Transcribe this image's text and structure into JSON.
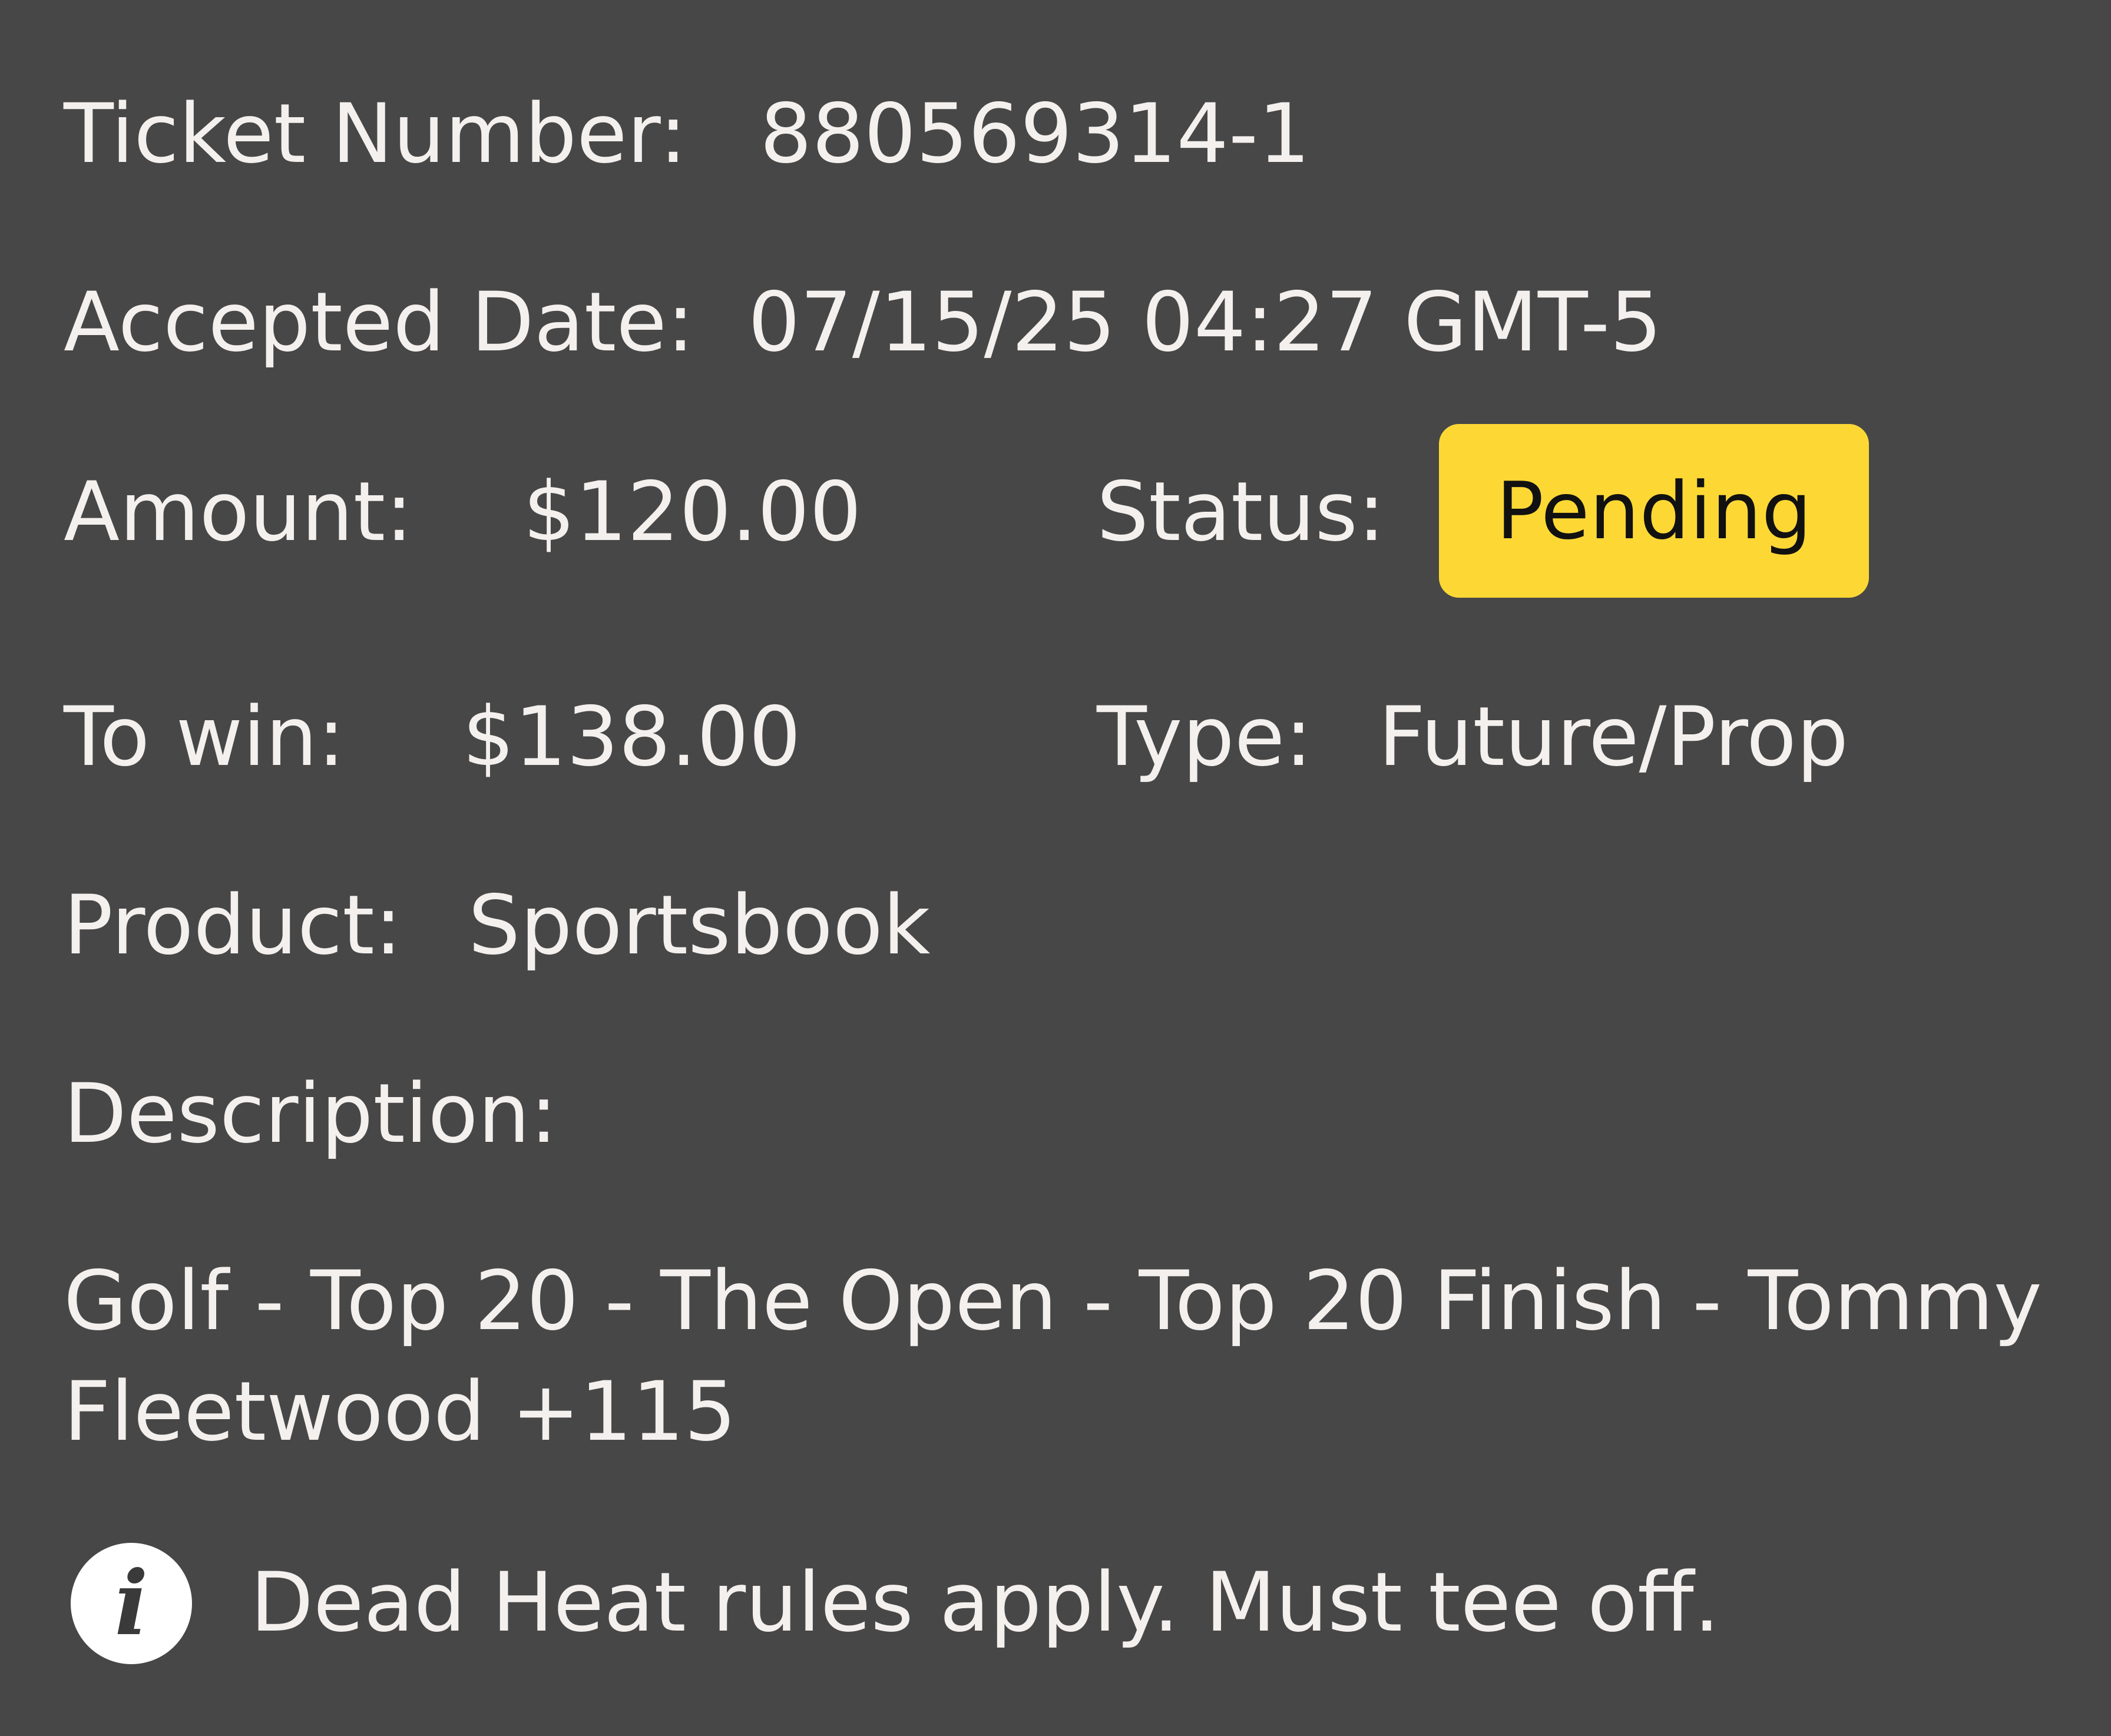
{
  "ticket": {
    "ticket_number_label": "Ticket Number:",
    "ticket_number": "880569314-1",
    "accepted_date_label": "Accepted Date:",
    "accepted_date": "07/15/25 04:27 GMT-5",
    "amount_label": "Amount:",
    "amount": "$120.00",
    "status_label": "Status:",
    "status": "Pending",
    "to_win_label": "To win:",
    "to_win": "$138.00",
    "type_label": "Type:",
    "type": "Future/Prop",
    "product_label": "Product:",
    "product": "Sportsbook",
    "description_label": "Description:",
    "description_line1": "Golf - Top 20 - The Open - Top 20 Finish - Tommy",
    "description_line2": "Fleetwood +115",
    "note": "Dead Heat rules apply. Must tee off.",
    "info_icon_glyph": "i"
  },
  "colors": {
    "background": "#474747",
    "text": "#f3f0ee",
    "status_badge": "#fdd835",
    "status_text": "#111111"
  },
  "icons": {
    "info": "info-icon"
  }
}
